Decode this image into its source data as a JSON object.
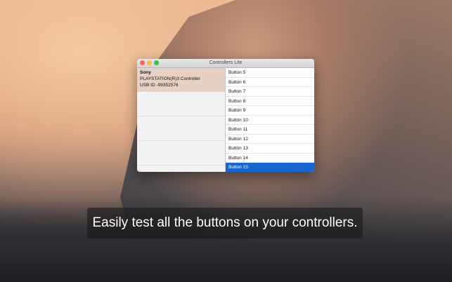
{
  "window": {
    "title": "Controllers Lite"
  },
  "device": {
    "brand": "Sony",
    "name": "PLAYSTATION(R)3 Controller",
    "usb": "USB ID -99352576"
  },
  "buttons": [
    {
      "label": "Button 5"
    },
    {
      "label": "Button 6"
    },
    {
      "label": "Button 7"
    },
    {
      "label": "Button 8"
    },
    {
      "label": "Button 9"
    },
    {
      "label": "Button 10"
    },
    {
      "label": "Button 11"
    },
    {
      "label": "Button 12"
    },
    {
      "label": "Button 13"
    },
    {
      "label": "Button 14"
    },
    {
      "label": "Button 15"
    }
  ],
  "caption": "Easily test all the buttons on your controllers."
}
